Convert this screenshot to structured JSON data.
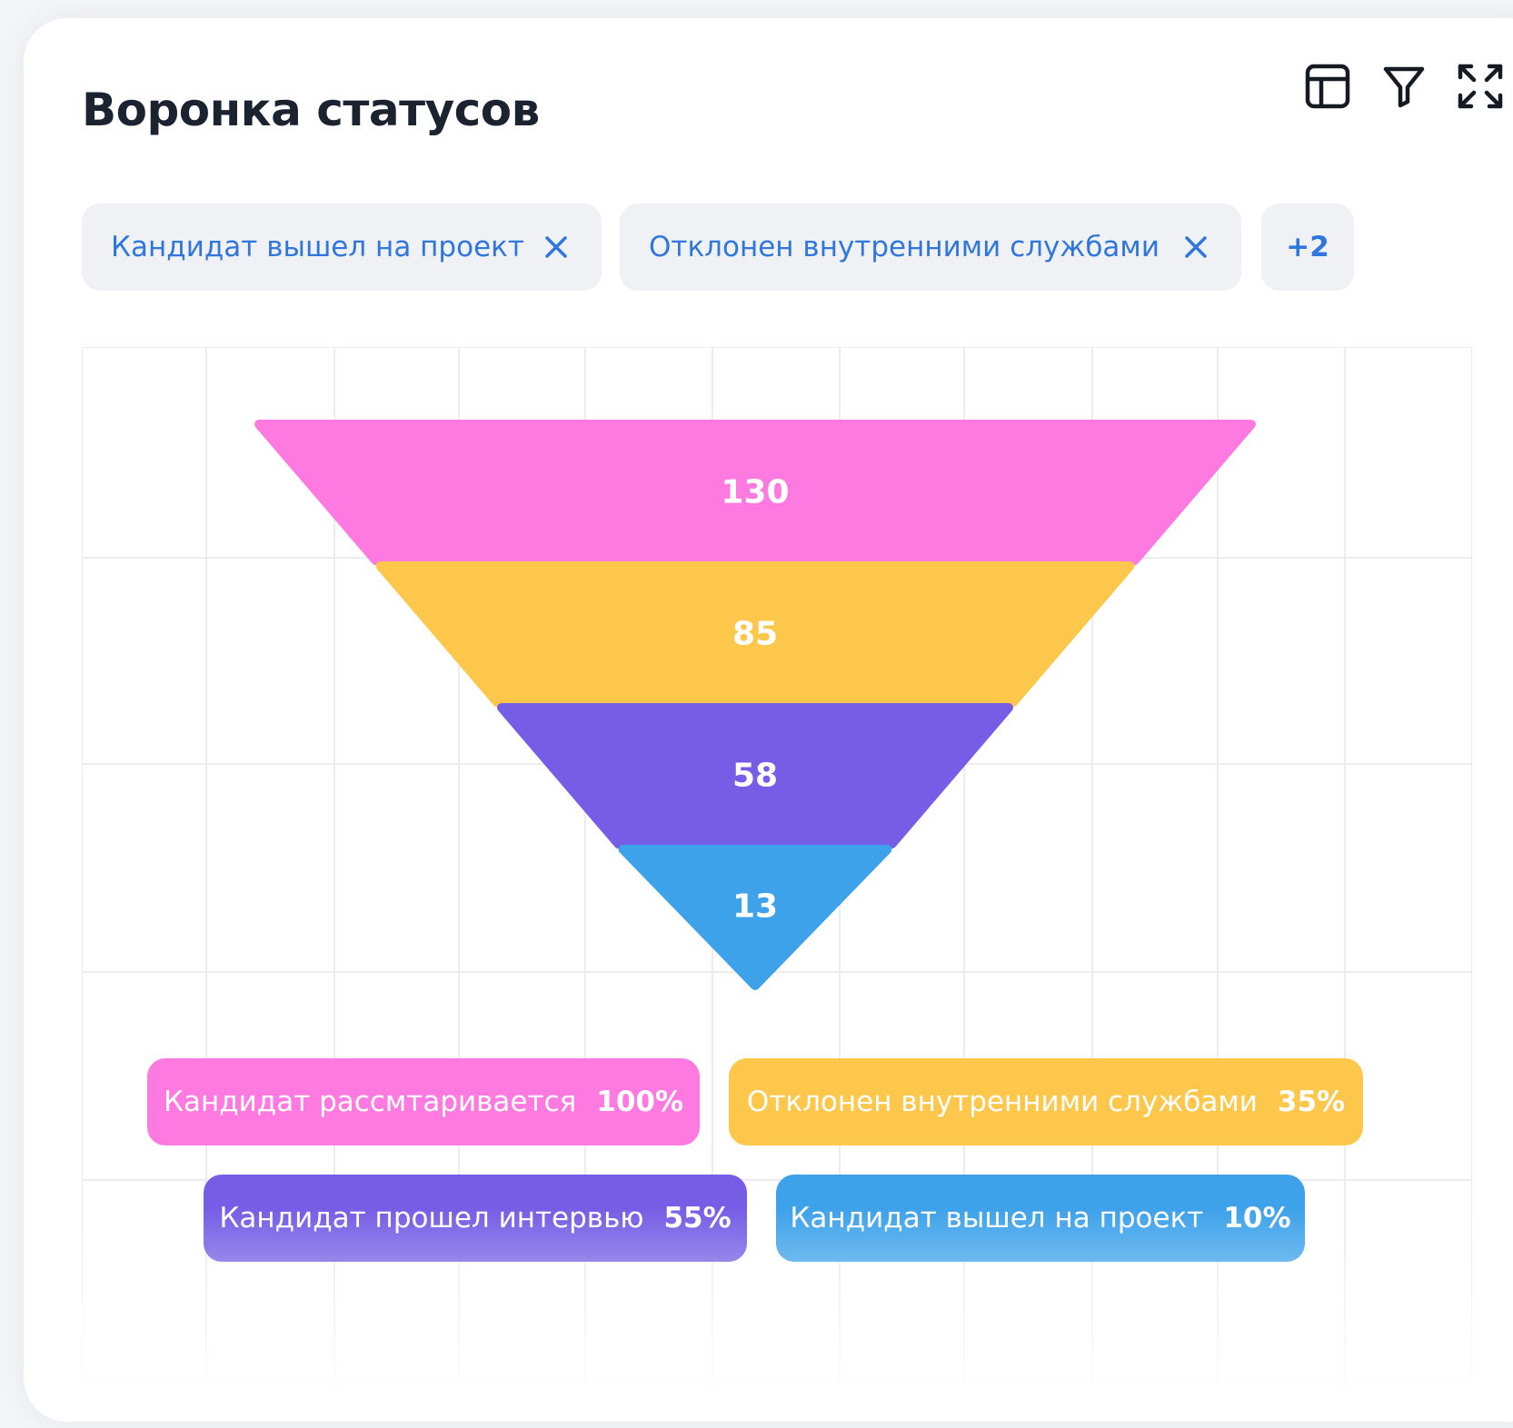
{
  "header": {
    "title": "Воронка статусов"
  },
  "toolbar": {
    "icons": [
      "table-icon",
      "filter-icon",
      "expand-icon"
    ]
  },
  "filters": {
    "chips": [
      {
        "label": "Кандидат вышел на проект"
      },
      {
        "label": "Отклонен внутренними службами"
      }
    ],
    "more_label": "+2"
  },
  "colors": {
    "pink": "#ff7ae0",
    "yellow": "#fdc74b",
    "purple": "#755ee5",
    "blue": "#3ea2ea",
    "chip_text": "#3077dd",
    "grid": "#ececef"
  },
  "chart_data": {
    "type": "funnel",
    "values": [
      130,
      85,
      58,
      13
    ],
    "legend": [
      {
        "label": "Кандидат рассмтаривается",
        "percent": "100%",
        "color": "#ff7ae0"
      },
      {
        "label": "Отклонен внутренними службами",
        "percent": "35%",
        "color": "#fdc74b"
      },
      {
        "label": "Кандидат прошел интервью",
        "percent": "55%",
        "color": "#755ee5"
      },
      {
        "label": "Кандидат вышел на проект",
        "percent": "10%",
        "color": "#3ea2ea"
      }
    ],
    "grid": true
  }
}
